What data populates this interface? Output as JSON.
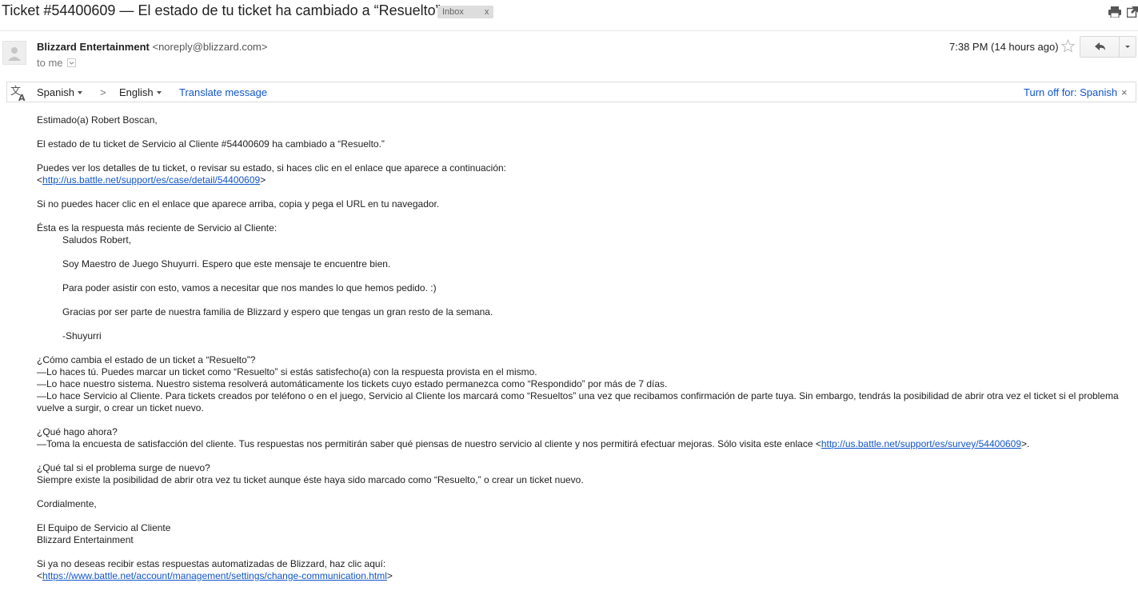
{
  "subject": {
    "title": "Ticket #54400609 — El estado de tu ticket ha cambiado a “Resuelto”",
    "label": "Inbox",
    "label_close": "x",
    "print_icon": "print-icon",
    "new_window_icon": "new-window-icon"
  },
  "header": {
    "avatar_icon": "person-icon",
    "sender_name": "Blizzard Entertainment",
    "sender_email": "<noreply@blizzard.com>",
    "to": "to me",
    "date": "7:38 PM (14 hours ago)",
    "star_icon": "star-icon",
    "reply_icon": "reply-icon",
    "more_icon": "chevron-down-icon"
  },
  "translate": {
    "icon": "translate-icon",
    "source_lang": "Spanish",
    "arrow": ">",
    "target_lang": "English",
    "translate_link": "Translate message",
    "turn_off": "Turn off for: Spanish",
    "close": "×"
  },
  "body": {
    "greeting": "Estimado(a) Robert Boscan,",
    "status_line": "El estado de tu ticket de Servicio al Cliente #54400609 ha cambiado a “Resuelto.”",
    "details_line": "Puedes ver los detalles de tu ticket, o revisar su estado, si haces clic en el enlace que aparece a continuación:",
    "details_link": "http://us.battle.net/support/es/case/detail/54400609",
    "copy_line": "Si no puedes hacer clic en el enlace que aparece arriba, copia y pega el URL en tu navegador.",
    "recent_line": "Ésta es la respuesta más reciente de Servicio al Cliente:",
    "reply_greeting": "Saludos Robert,",
    "reply_intro": "Soy Maestro de Juego Shuyurri. Espero que este mensaje te encuentre bien.",
    "reply_assist": "Para poder asistir con esto, vamos a necesitar que nos mandes lo que hemos pedido. :)",
    "reply_thanks": "Gracias por ser parte de nuestra familia de Blizzard y espero que tengas un gran resto de la semana.",
    "reply_signature": "-Shuyurri",
    "how_q": "¿Cómo cambia el estado de un ticket a “Resuelto”?",
    "how_1": "—Lo haces tú. Puedes marcar un ticket como “Resuelto” si estás satisfecho(a) con la respuesta provista en el mismo.",
    "how_2": "—Lo hace nuestro sistema. Nuestro sistema resolverá automáticamente los tickets cuyo estado permanezca como “Respondido” por más de 7 días.",
    "how_3": "—Lo hace Servicio al Cliente. Para tickets creados por teléfono o en el juego, Servicio al Cliente los marcará como “Resueltos” una vez que recibamos confirmación de parte tuya. Sin embargo, tendrás la posibilidad de abrir otra vez el ticket si el problema vuelve a surgir, o crear un ticket nuevo.",
    "what_q": "¿Qué hago ahora?",
    "what_a": "—Toma la encuesta de satisfacción del cliente. Tus respuestas nos permitirán saber qué piensas de nuestro servicio al cliente y nos permitirá efectuar mejoras. Sólo visita este enlace ",
    "survey_link": "http://us.battle.net/support/es/survey/54400609",
    "again_q": "¿Qué tal si el problema surge de nuevo?",
    "again_a": "Siempre existe la posibilidad de abrir otra vez tu ticket aunque éste haya sido marcado como “Resuelto,” o crear un ticket nuevo.",
    "closing": "Cordialmente,",
    "team": "El Equipo de Servicio al Cliente",
    "company": "Blizzard Entertainment",
    "unsub_line": "Si ya no deseas recibir estas respuestas automatizadas de Blizzard, haz clic aquí:",
    "unsub_link": "https://www.battle.net/account/management/settings/change-communication.html"
  }
}
